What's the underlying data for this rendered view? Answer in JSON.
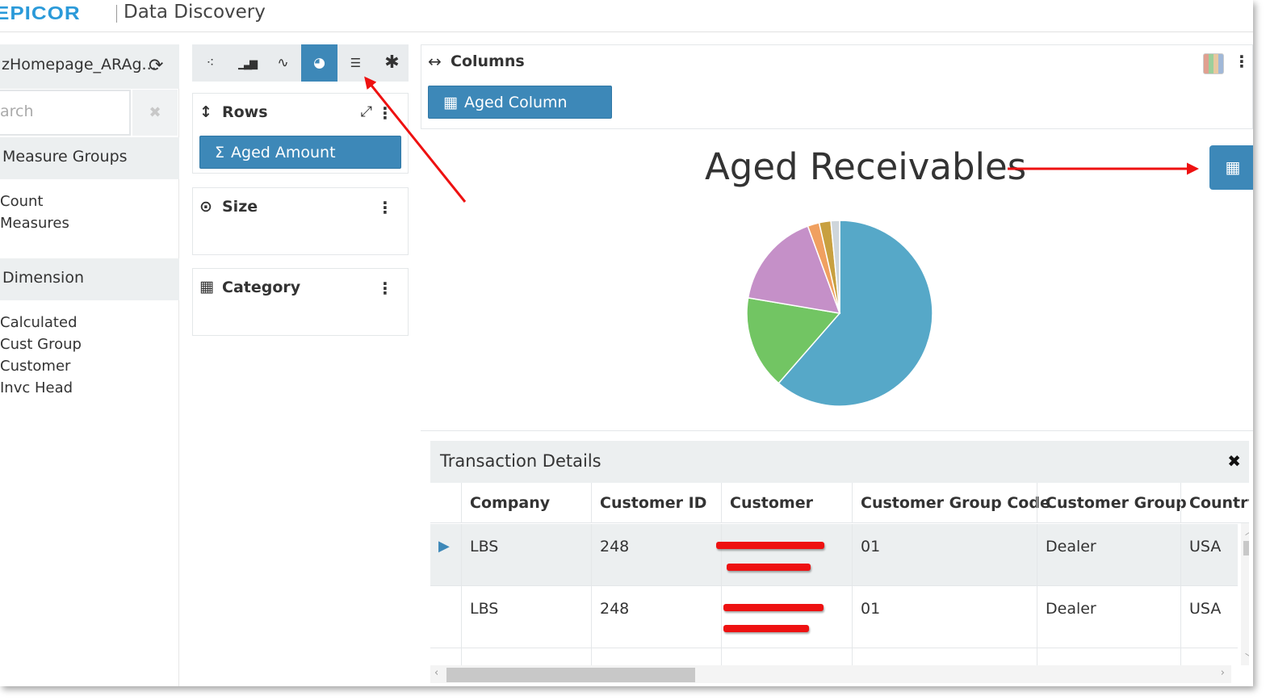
{
  "header": {
    "logo": "EPICOR",
    "app_title": "Data Discovery"
  },
  "left_panel": {
    "dataset_name": "zHomepage_ARAg...",
    "search_placeholder": "arch",
    "measure_groups_label": "Measure Groups",
    "measure_items": [
      "Count",
      "Measures"
    ],
    "dimension_label": "Dimension",
    "dimension_items": [
      "Calculated",
      "Cust Group",
      "Customer",
      "Invc Head"
    ]
  },
  "toolbar": {
    "buttons": [
      {
        "name": "scatter-icon",
        "glyph": "⁖"
      },
      {
        "name": "bar-chart-icon",
        "glyph": "▁▃▅"
      },
      {
        "name": "line-chart-icon",
        "glyph": "〰"
      },
      {
        "name": "pie-chart-icon",
        "glyph": "◕"
      },
      {
        "name": "list-icon",
        "glyph": "☰"
      },
      {
        "name": "star-icon",
        "glyph": "✱"
      }
    ],
    "active_index": 3
  },
  "rows_card": {
    "title": "Rows",
    "pill": "Aged Amount",
    "pill_icon": "Σ"
  },
  "size_card": {
    "title": "Size"
  },
  "category_card": {
    "title": "Category"
  },
  "columns_bar": {
    "title": "Columns",
    "pill": "Aged Column"
  },
  "chart_data": {
    "type": "pie",
    "title": "Aged Receivables",
    "slices": [
      {
        "value": 60.5,
        "color": "#56a8c8"
      },
      {
        "value": 16.0,
        "color": "#72c563"
      },
      {
        "value": 16.5,
        "color": "#c590c8"
      },
      {
        "value": 2.0,
        "color": "#f0a060"
      },
      {
        "value": 2.0,
        "color": "#c8a040"
      },
      {
        "value": 1.5,
        "color": "#cfd6db"
      }
    ]
  },
  "details": {
    "title": "Transaction Details",
    "columns": [
      "Company",
      "Customer ID",
      "Customer",
      "Customer Group Code",
      "Customer Group",
      "Country"
    ],
    "rows": [
      {
        "company": "LBS",
        "customer_id": "248",
        "group_code": "01",
        "group": "Dealer",
        "country": "USA"
      },
      {
        "company": "LBS",
        "customer_id": "248",
        "group_code": "01",
        "group": "Dealer",
        "country": "USA"
      }
    ]
  }
}
